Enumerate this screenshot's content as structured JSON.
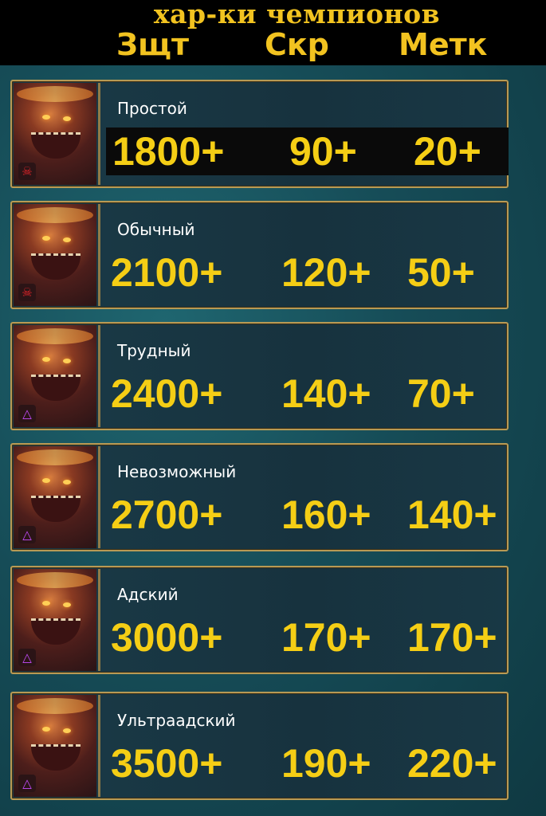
{
  "header": {
    "title": "хар-ки чемпионов",
    "columns": [
      "Зщт",
      "Скр",
      "Метк"
    ]
  },
  "colors": {
    "accent": "#f5ce15",
    "background": "#164c57",
    "frame": "#b79a55",
    "skull": "#e8252a",
    "triangle": "#c64cff"
  },
  "rows": [
    {
      "name": "Простой",
      "def": "1800+",
      "spd": "90+",
      "acc": "20+",
      "icon": "skull-icon"
    },
    {
      "name": "Обычный",
      "def": "2100+",
      "spd": "120+",
      "acc": "50+",
      "icon": "skull-icon"
    },
    {
      "name": "Трудный",
      "def": "2400+",
      "spd": "140+",
      "acc": "70+",
      "icon": "triangle-icon"
    },
    {
      "name": "Невозможный",
      "def": "2700+",
      "spd": "160+",
      "acc": "140+",
      "icon": "triangle-icon"
    },
    {
      "name": "Адский",
      "def": "3000+",
      "spd": "170+",
      "acc": "170+",
      "icon": "triangle-icon"
    },
    {
      "name": "Ультраадский",
      "def": "3500+",
      "spd": "190+",
      "acc": "220+",
      "icon": "triangle-icon"
    }
  ]
}
